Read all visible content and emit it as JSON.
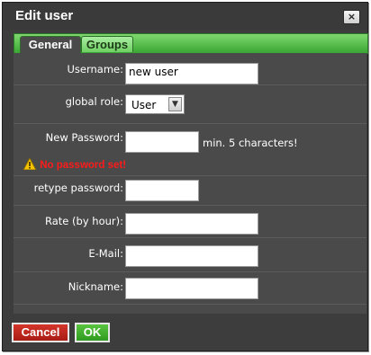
{
  "dialog": {
    "title": "Edit user",
    "close_label": "×"
  },
  "tabs": [
    {
      "label": "General",
      "active": true
    },
    {
      "label": "Groups",
      "active": false
    }
  ],
  "form": {
    "username_label": "Username:",
    "username_value": "new user",
    "role_label": "global role:",
    "role_value": "User",
    "password_label": "New Password:",
    "password_value": "",
    "password_hint": "min. 5 characters!",
    "password_warning": "No password set!",
    "retype_label": "retype password:",
    "retype_value": "",
    "rate_label": "Rate (by hour):",
    "rate_value": "",
    "email_label": "E-Mail:",
    "email_value": "",
    "nickname_label": "Nickname:",
    "nickname_value": ""
  },
  "buttons": {
    "cancel_label": "Cancel",
    "ok_label": "OK"
  },
  "colors": {
    "tab_accent": "#3aa633",
    "cancel": "#c0281f",
    "ok": "#45b030",
    "warning": "#ff1a1a"
  },
  "icons": {
    "close": "close-icon",
    "warning": "warning-icon",
    "dropdown": "chevron-down-icon"
  }
}
